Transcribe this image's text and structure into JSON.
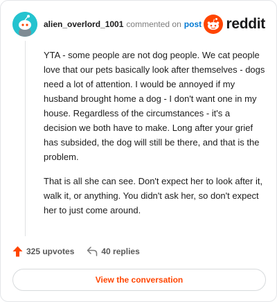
{
  "header": {
    "username": "alien_overlord_1001",
    "action_text": "commented on",
    "post_link": "post",
    "brand": "reddit",
    "brand_color": "#ff4500",
    "avatar_color": "#24c3cf"
  },
  "comment": {
    "paragraphs": [
      "YTA - some people are not dog people. We cat people love that our pets basically look after themselves - dogs need a lot of attention. I would be annoyed if my husband brought home a dog - I don't want one in my house. Regardless of the circumstances - it's a decision we both have to make. Long after your grief has subsided, the dog will still be there, and that is the problem.",
      "That is all she can see. Don't expect her to look after it, walk it, or anything. You didn't ask her, so don't expect her to just come around."
    ]
  },
  "footer": {
    "upvotes": "325 upvotes",
    "replies": "40 replies",
    "upvote_icon": "upvote-arrow-icon",
    "reply_icon": "reply-arrow-icon"
  },
  "cta": {
    "label": "View the conversation"
  }
}
